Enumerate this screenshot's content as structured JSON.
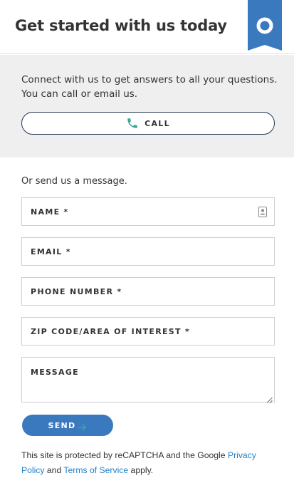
{
  "header": {
    "title": "Get started with us today"
  },
  "contact": {
    "intro": "Connect with us to get answers to all your questions. You can call or email us.",
    "call_label": "CALL"
  },
  "form": {
    "intro": "Or send us a message.",
    "fields": {
      "name": "NAME *",
      "email": "EMAIL *",
      "phone": "PHONE NUMBER *",
      "zip": "ZIP CODE/AREA OF INTEREST *",
      "message": "MESSAGE"
    },
    "send_label": "SEND"
  },
  "recaptcha": {
    "prefix": "This site is protected by reCAPTCHA and the Google ",
    "privacy_link": "Privacy Policy",
    "middle": " and ",
    "terms_link": "Terms of Service",
    "suffix": " apply."
  },
  "colors": {
    "brand_blue": "#3b79bf",
    "call_border": "#1f3550",
    "phone_icon": "#3fa39a",
    "link": "#1f80c7",
    "panel_bg": "#efefef"
  },
  "icons": {
    "brand": "brand-bookmark-icon",
    "call": "phone-icon",
    "name_field": "contact-card-icon",
    "send": "arrow-right-icon",
    "message": "resize-grip-icon"
  }
}
